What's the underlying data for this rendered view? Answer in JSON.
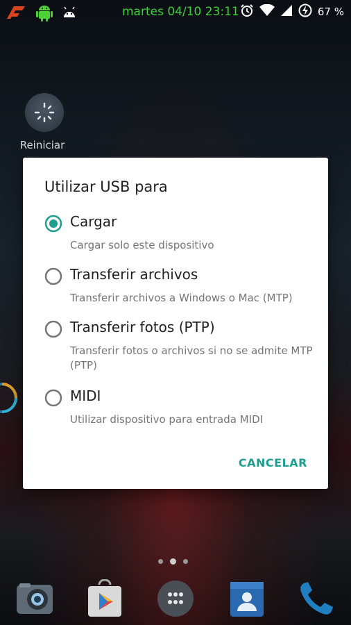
{
  "status_bar": {
    "datetime": "martes 04/10 23:11",
    "battery": "67 %",
    "icons": [
      "ferrari-icon",
      "android-icon",
      "android-head-icon",
      "alarm-icon",
      "wifi-icon",
      "signal-icon",
      "battery-charging-icon"
    ]
  },
  "desktop": {
    "shortcut_label": "Reiniciar"
  },
  "dialog": {
    "title": "Utilizar USB para",
    "options": [
      {
        "label": "Cargar",
        "description": "Cargar solo este dispositivo",
        "selected": true
      },
      {
        "label": "Transferir archivos",
        "description": "Transferir archivos a Windows o Mac (MTP)",
        "selected": false
      },
      {
        "label": "Transferir fotos (PTP)",
        "description": "Transferir fotos o archivos si no se admite MTP (PTP)",
        "selected": false
      },
      {
        "label": "MIDI",
        "description": "Utilizar dispositivo para entrada MIDI",
        "selected": false
      }
    ],
    "cancel_label": "CANCELAR"
  },
  "dock": {
    "items": [
      "camera-icon",
      "play-store-icon",
      "app-drawer-icon",
      "contacts-icon",
      "phone-icon"
    ]
  },
  "colors": {
    "accent": "#1e9e8f",
    "status_green": "#3ad13a"
  }
}
